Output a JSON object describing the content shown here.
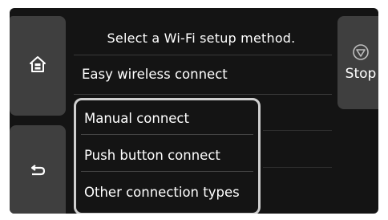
{
  "screen": {
    "title": "Select a Wi-Fi setup method."
  },
  "side_buttons": {
    "home_icon": "home-icon",
    "back_icon": "back-arrow-icon",
    "stop_label": "Stop",
    "stop_icon": "stop-icon"
  },
  "menu": {
    "items": [
      {
        "label": "Easy wireless connect"
      },
      {
        "label": "Manual connect"
      },
      {
        "label": "Push button connect"
      },
      {
        "label": "Other connection types"
      }
    ]
  },
  "colors": {
    "background": "#141414",
    "button": "#3f3f3f",
    "highlight_border": "#cfcfcf",
    "text": "#ffffff"
  }
}
